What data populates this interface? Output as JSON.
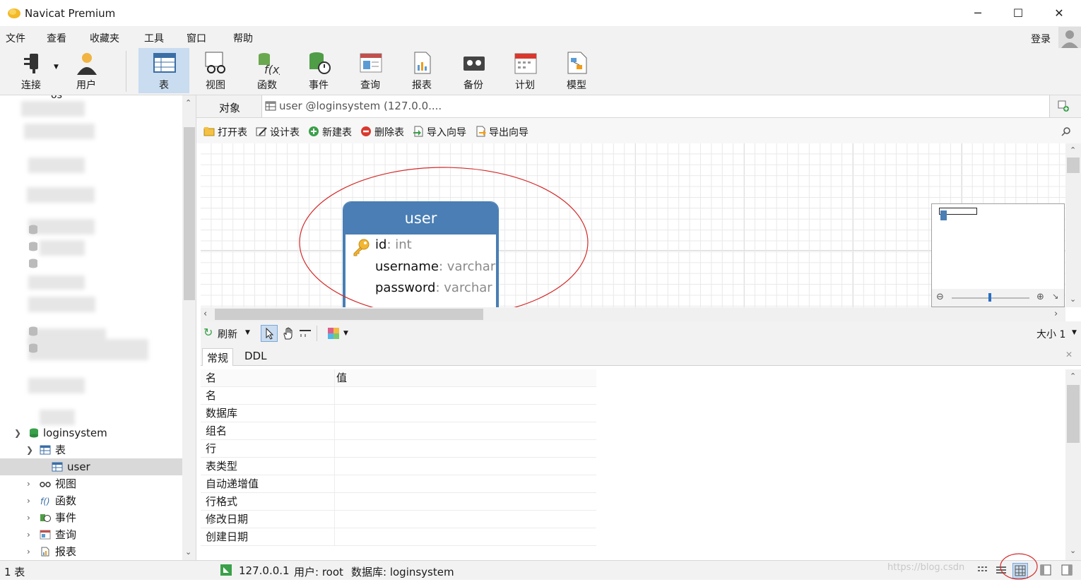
{
  "window": {
    "title": "Navicat Premium",
    "minimize": "─",
    "maximize": "☐",
    "close": "✕"
  },
  "menu": [
    "文件",
    "查看",
    "收藏夹",
    "工具",
    "窗口",
    "帮助"
  ],
  "account": {
    "login_label": "登录"
  },
  "toolbar": {
    "connect": "连接",
    "user": "用户",
    "table": "表",
    "view": "视图",
    "function": "函数",
    "event": "事件",
    "query": "查询",
    "report": "报表",
    "backup": "备份",
    "schedule": "计划",
    "model": "模型"
  },
  "sidebar": {
    "partial_item": "os",
    "db": {
      "label": "loginsystem"
    },
    "tables_group": "表",
    "table_item": "user",
    "groups": [
      "视图",
      "函数",
      "事件",
      "查询",
      "报表"
    ]
  },
  "tabs": {
    "objects": "对象",
    "active_tab": "user @loginsystem (127.0.0...."
  },
  "actions": {
    "open": "打开表",
    "design": "设计表",
    "new": "新建表",
    "delete": "删除表",
    "import": "导入向导",
    "export": "导出向导"
  },
  "entity": {
    "name": "user",
    "fields": [
      {
        "name": "id",
        "sep": ": ",
        "type": "int",
        "primary_key": true
      },
      {
        "name": "username",
        "sep": ": ",
        "type": "varchar",
        "primary_key": false
      },
      {
        "name": "password",
        "sep": ": ",
        "type": "varchar",
        "primary_key": false
      }
    ]
  },
  "canvas_tools": {
    "refresh": "刷新",
    "size_label": "大小 1"
  },
  "info_tabs": {
    "general": "常规",
    "ddl": "DDL"
  },
  "properties": {
    "headers": {
      "key": "名",
      "value": "值"
    },
    "rows": [
      "名",
      "数据库",
      "组名",
      "行",
      "表类型",
      "自动递增值",
      "行格式",
      "修改日期",
      "创建日期"
    ]
  },
  "status": {
    "count": "1 表",
    "host": "127.0.0.1",
    "user": "用户: root",
    "database": "数据库: loginsystem",
    "watermark": "https://blog.csdn"
  },
  "colors": {
    "accent": "#4a7eb4",
    "selection": "#c9dcf0",
    "annotation": "#d42a2a"
  }
}
